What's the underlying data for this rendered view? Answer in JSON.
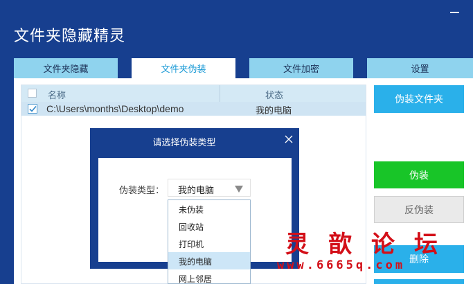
{
  "app": {
    "title": "文件夹隐藏精灵"
  },
  "tabs": [
    {
      "label": "文件夹隐藏"
    },
    {
      "label": "文件夹伪装"
    },
    {
      "label": "文件加密"
    },
    {
      "label": "设置"
    }
  ],
  "active_tab": "文件夹伪装",
  "list": {
    "columns": {
      "name": "名称",
      "status": "状态"
    },
    "rows": [
      {
        "checked": true,
        "path": "C:\\Users\\months\\Desktop\\demo",
        "status": "我的电脑"
      }
    ]
  },
  "side_buttons": {
    "disguise_folder": "伪装文件夹",
    "disguise": "伪装",
    "undisguise": "反伪装",
    "delete": "删除"
  },
  "dialog": {
    "title": "请选择伪装类型",
    "type_label": "伪装类型：",
    "selected": "我的电脑",
    "options": [
      "未伪装",
      "回收站",
      "打印机",
      "我的电脑",
      "网上邻居"
    ]
  },
  "watermark": {
    "text": "灵歆论坛",
    "url": "www.6665q.com"
  },
  "colors": {
    "title_bar": "#173f8f",
    "tab_inactive": "#8fd3ee",
    "tab_active_text": "#1a9ad6",
    "button_blue": "#2ab0ea",
    "button_green": "#18c528",
    "watermark": "#d30f18"
  }
}
